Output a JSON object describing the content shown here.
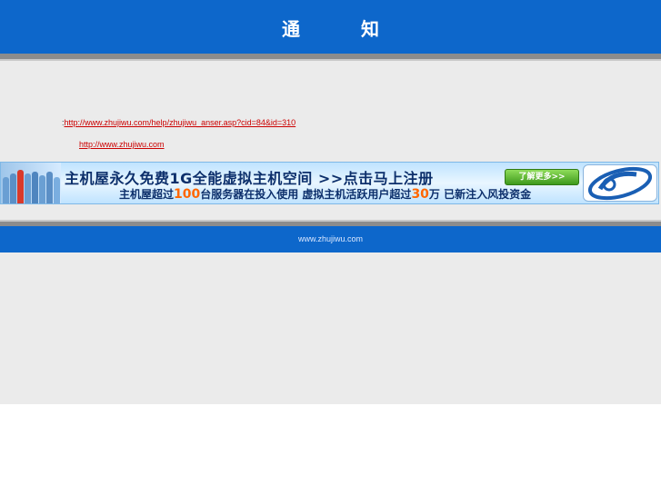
{
  "header": {
    "title": "通  知"
  },
  "notice": {
    "prefix": ":",
    "link1": "http://www.zhujiwu.com/help/zhujiwu_anser.asp?cid=84&id=310",
    "link2": "http://www.zhujiwu.com"
  },
  "banner": {
    "line1": "主机屋永久免费1G全能虚拟主机空间 >>点击马上注册",
    "line2_a": "主机屋超过",
    "line2_b": "100",
    "line2_c": "台服务器在投入使用  虚拟主机活跃用户超过",
    "line2_d": "30",
    "line2_e": "万  已新注入风投资金",
    "button_label": "了解更多>>"
  },
  "footer": {
    "text": "www.zhujiwu.com"
  },
  "colors": {
    "header_blue": "#0d67cb",
    "page_gray": "#ebebeb",
    "link_red": "#cc0000",
    "highlight_orange": "#ff6600"
  }
}
